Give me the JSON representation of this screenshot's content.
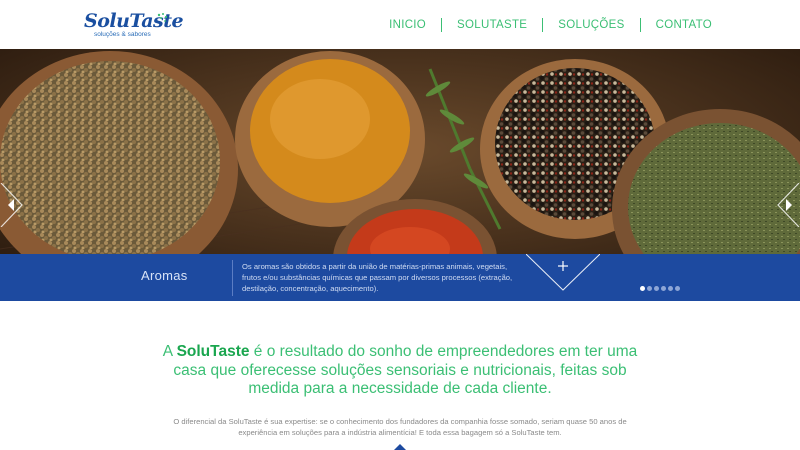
{
  "logo": {
    "main": "SoluTaste",
    "sub": "soluções & sabores"
  },
  "nav": {
    "items": [
      {
        "label": "INICIO"
      },
      {
        "label": "SOLUTASTE"
      },
      {
        "label": "SOLUÇÕES"
      },
      {
        "label": "CONTATO"
      }
    ]
  },
  "hero": {
    "slide_title": "Aromas",
    "slide_text": "Os aromas são obtidos a partir da união de matérias-primas animais, vegetais, frutos e/ou substâncias químicas que passam por diversos processos (extração, destilação, concentração, aquecimento).",
    "plus_symbol": "+",
    "slide_count": 6,
    "active_slide": 1
  },
  "body": {
    "headline_prefix": "A ",
    "headline_brand": "SoluTaste",
    "headline_rest": " é o resultado do sonho de empreendedores em ter uma casa que oferecesse soluções sensoriais e nutricionais, feitas sob medida para a necessidade de cada cliente.",
    "paragraph": "O diferencial da SoluTaste é sua expertise: se o conhecimento dos fundadores da companhia fosse somado, seriam quase 50 anos de experiência em soluções para a indústria alimentícia! E toda essa bagagem só a SoluTaste tem."
  },
  "colors": {
    "brand_blue": "#1d4aa0",
    "brand_green": "#3bbf74",
    "logo_blue": "#1a4fa0"
  },
  "icons": {
    "logo_mark": "sparkle-dots-icon",
    "prev": "chevron-left-icon",
    "next": "chevron-right-icon",
    "plus": "plus-icon",
    "scroll": "caret-down-icon"
  }
}
